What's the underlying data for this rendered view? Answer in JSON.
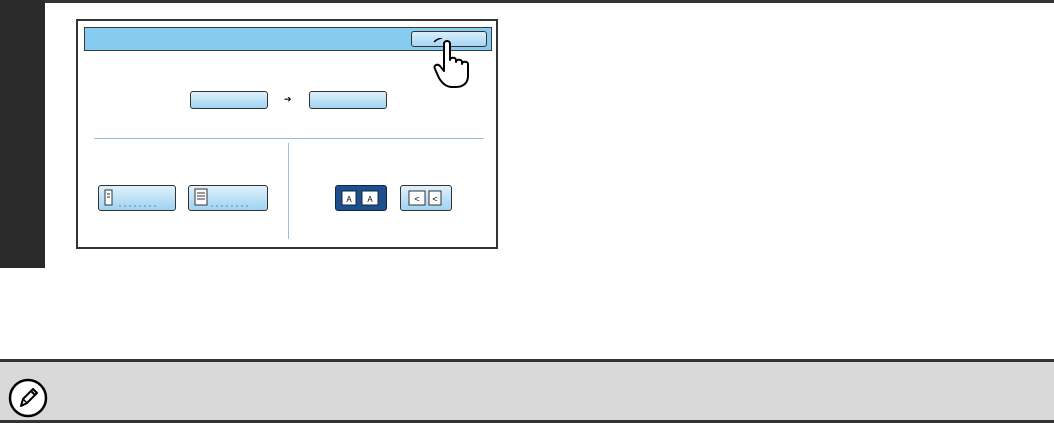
{
  "step": {
    "number": ""
  },
  "panel": {
    "header_title": "",
    "ok_label": "",
    "size_from_label": "",
    "size_to_label": "",
    "orientation_left_label": "",
    "orientation_right_label": "",
    "layout_option_1": "",
    "layout_option_2": ""
  },
  "icons": {
    "pointer": "hand-pointer-icon",
    "note": "pencil-note-icon"
  },
  "colors": {
    "header_blue": "#86cbf0",
    "button_blue": "#a6d6f2",
    "selected_button": "#1f4f8a",
    "note_bar": "#d9d9d9"
  },
  "note": {
    "text": ""
  }
}
